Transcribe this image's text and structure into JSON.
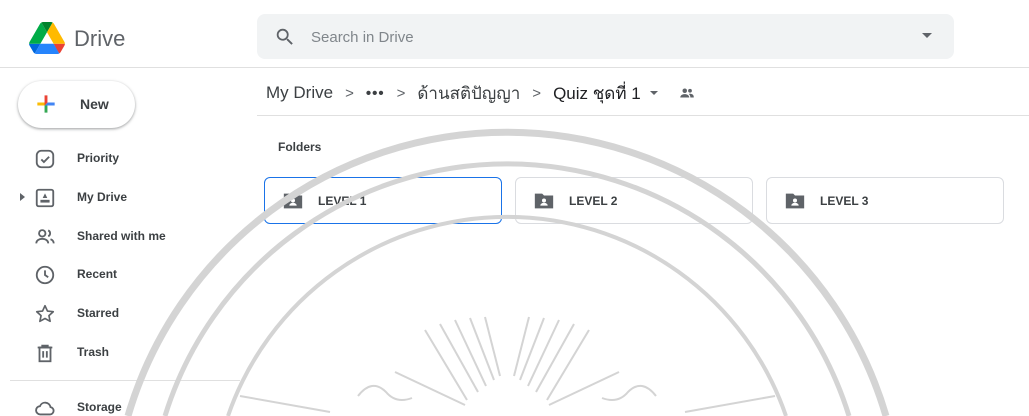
{
  "app": {
    "name": "Drive",
    "logo_icon": "google-drive-logo-icon"
  },
  "search": {
    "placeholder": "Search in Drive",
    "value": "",
    "icon": "search-icon",
    "options_icon": "caret-down-icon"
  },
  "sidebar": {
    "new_label": "New",
    "items": [
      {
        "label": "Priority",
        "icon": "priority-check-icon"
      },
      {
        "label": "My Drive",
        "icon": "my-drive-icon"
      },
      {
        "label": "Shared with me",
        "icon": "shared-people-icon"
      },
      {
        "label": "Recent",
        "icon": "clock-icon"
      },
      {
        "label": "Starred",
        "icon": "star-icon"
      },
      {
        "label": "Trash",
        "icon": "trash-icon"
      },
      {
        "label": "Storage",
        "icon": "cloud-icon"
      }
    ]
  },
  "breadcrumb": {
    "root": "My Drive",
    "more": "•••",
    "middle": "ด้านสติปัญญา",
    "current": "Quiz ชุดที่ 1",
    "separator": ">"
  },
  "folders_section": {
    "title": "Folders",
    "folders": [
      {
        "name": "LEVEL 1",
        "selected": true
      },
      {
        "name": "LEVEL 2",
        "selected": false
      },
      {
        "name": "LEVEL 3",
        "selected": false
      }
    ]
  },
  "colors": {
    "accent": "#1a73e8",
    "text": "#3c4043",
    "icon": "#5f6368",
    "search_bg": "#f1f3f4",
    "border": "#dadce0"
  }
}
